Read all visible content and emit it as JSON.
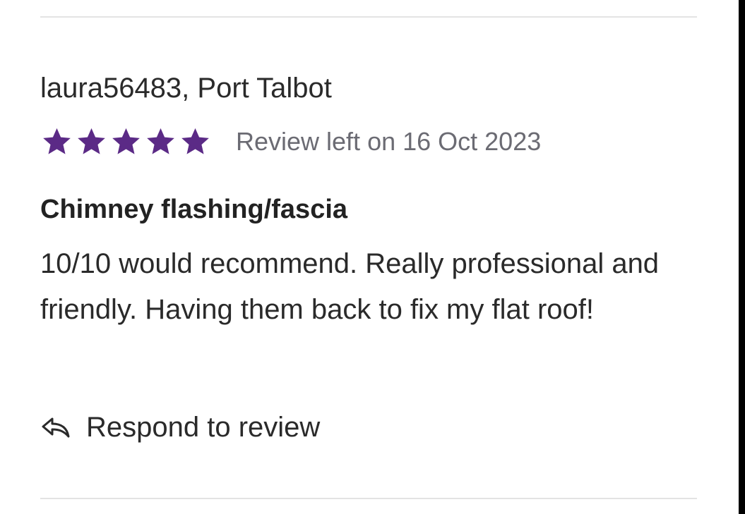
{
  "review": {
    "reviewer": "laura56483, Port Talbot",
    "rating": 5,
    "max_rating": 5,
    "star_icon": "star-icon",
    "star_color": "#5b2a86",
    "date_text": "Review left on 16 Oct 2023",
    "title": "Chimney flashing/fascia",
    "body": "10/10 would recommend. Really professional and friendly. Having them back to fix my flat roof!",
    "respond_icon": "reply-arrow-icon",
    "respond_label": "Respond to review"
  }
}
